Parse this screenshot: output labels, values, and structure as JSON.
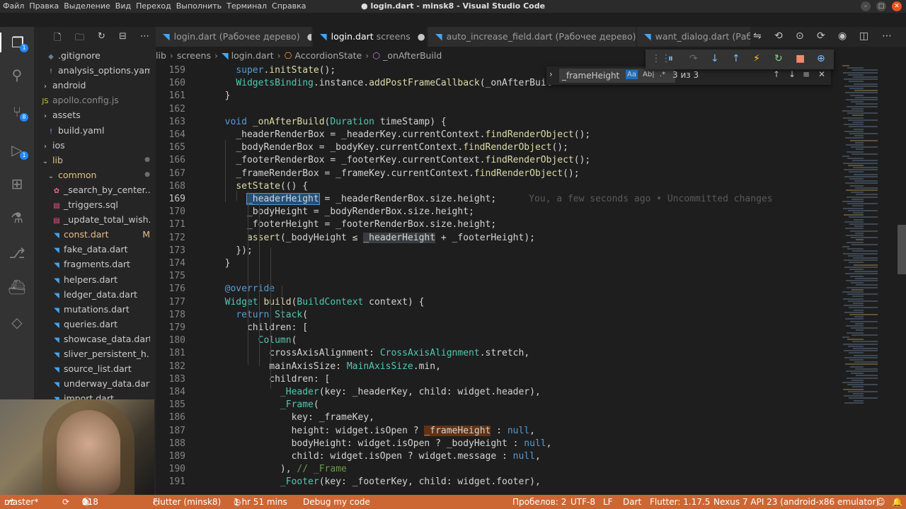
{
  "window": {
    "menu": [
      "Файл",
      "Правка",
      "Выделение",
      "Вид",
      "Переход",
      "Выполнить",
      "Терминал",
      "Справка"
    ],
    "title": "login.dart - minsk8 - Visual Studio Code"
  },
  "explorer": {
    "items": [
      {
        "label": ".gitignore",
        "icon": "git-icon",
        "chev": "",
        "state": "normal",
        "marker": ""
      },
      {
        "label": "analysis_options.yaml",
        "icon": "exclamation-icon",
        "chev": "",
        "state": "normal",
        "marker": ""
      },
      {
        "label": "android",
        "icon": "",
        "chev": "›",
        "state": "normal",
        "marker": ""
      },
      {
        "label": "apollo.config.js",
        "icon": "js-icon",
        "chev": "",
        "state": "dim",
        "marker": ""
      },
      {
        "label": "assets",
        "icon": "",
        "chev": "›",
        "state": "normal",
        "marker": ""
      },
      {
        "label": "build.yaml",
        "icon": "exclamation-icon",
        "chev": "",
        "state": "normal",
        "marker": ""
      },
      {
        "label": "ios",
        "icon": "",
        "chev": "›",
        "state": "normal",
        "marker": ""
      },
      {
        "label": "lib",
        "icon": "",
        "chev": "⌄",
        "state": "mod",
        "marker": "●"
      },
      {
        "label": "common",
        "icon": "",
        "chev": "⌄",
        "state": "mod",
        "marker": "●"
      },
      {
        "label": "_search_by_center....",
        "icon": "gear-icon",
        "chev": "",
        "state": "normal",
        "marker": ""
      },
      {
        "label": "_triggers.sql",
        "icon": "database-icon",
        "chev": "",
        "state": "normal",
        "marker": ""
      },
      {
        "label": "_update_total_wish...",
        "icon": "database-icon",
        "chev": "",
        "state": "normal",
        "marker": ""
      },
      {
        "label": "const.dart",
        "icon": "dart-icon",
        "chev": "",
        "state": "mod",
        "marker": "M"
      },
      {
        "label": "fake_data.dart",
        "icon": "dart-icon",
        "chev": "",
        "state": "normal",
        "marker": ""
      },
      {
        "label": "fragments.dart",
        "icon": "dart-icon",
        "chev": "",
        "state": "normal",
        "marker": ""
      },
      {
        "label": "helpers.dart",
        "icon": "dart-icon",
        "chev": "",
        "state": "normal",
        "marker": ""
      },
      {
        "label": "ledger_data.dart",
        "icon": "dart-icon",
        "chev": "",
        "state": "normal",
        "marker": ""
      },
      {
        "label": "mutations.dart",
        "icon": "dart-icon",
        "chev": "",
        "state": "normal",
        "marker": ""
      },
      {
        "label": "queries.dart",
        "icon": "dart-icon",
        "chev": "",
        "state": "normal",
        "marker": ""
      },
      {
        "label": "showcase_data.dart",
        "icon": "dart-icon",
        "chev": "",
        "state": "normal",
        "marker": ""
      },
      {
        "label": "sliver_persistent_h...",
        "icon": "dart-icon",
        "chev": "",
        "state": "normal",
        "marker": ""
      },
      {
        "label": "source_list.dart",
        "icon": "dart-icon",
        "chev": "",
        "state": "normal",
        "marker": ""
      },
      {
        "label": "underway_data.dart",
        "icon": "dart-icon",
        "chev": "",
        "state": "normal",
        "marker": ""
      },
      {
        "label": "import.dart",
        "icon": "dart-icon",
        "chev": "",
        "state": "normal",
        "marker": ""
      }
    ]
  },
  "activity_badges": {
    "scm": "8",
    "debug": "1",
    "explorer": "1"
  },
  "tabs": [
    {
      "label": "login.dart",
      "desc": "(Рабочее дерево)",
      "marker": "●",
      "active": false
    },
    {
      "label": "login.dart",
      "desc": "screens",
      "marker": "●",
      "active": true
    },
    {
      "label": "auto_increase_field.dart",
      "desc": "(Рабочее дерево)",
      "marker": "",
      "active": false
    },
    {
      "label": "want_dialog.dart",
      "desc": "(Рабо",
      "marker": "",
      "active": false
    }
  ],
  "breadcrumbs": [
    "lib",
    "screens",
    "login.dart",
    "AccordionState",
    "_onAfterBuild"
  ],
  "find": {
    "query": "_frameHeight",
    "case_label": "Aa",
    "word_label": "Ab|",
    "regex_label": ".*",
    "count": "3 из 3"
  },
  "code": {
    "blame": "You, a few seconds ago • Uncommitted changes",
    "current_line": "169",
    "lines": [
      {
        "n": "159",
        "segs": [
          [
            "    ",
            ""
          ],
          [
            "super",
            "kw"
          ],
          [
            ".",
            ""
          ],
          [
            "initState",
            "fn"
          ],
          [
            "();",
            ""
          ]
        ]
      },
      {
        "n": "160",
        "segs": [
          [
            "    ",
            ""
          ],
          [
            "WidgetsBinding",
            "ty"
          ],
          [
            ".",
            ""
          ],
          [
            "instance",
            ""
          ],
          [
            ".",
            ""
          ],
          [
            "addPostFrameCallback",
            "fn"
          ],
          [
            "(",
            ""
          ],
          [
            "_onAfterBuil",
            ""
          ]
        ]
      },
      {
        "n": "161",
        "segs": [
          [
            "  }",
            ""
          ]
        ]
      },
      {
        "n": "162",
        "segs": [
          [
            "",
            ""
          ]
        ]
      },
      {
        "n": "163",
        "segs": [
          [
            "  ",
            ""
          ],
          [
            "void",
            "kw"
          ],
          [
            " ",
            ""
          ],
          [
            "_onAfterBuild",
            "fn"
          ],
          [
            "(",
            ""
          ],
          [
            "Duration",
            "ty"
          ],
          [
            " timeStamp) {",
            ""
          ]
        ]
      },
      {
        "n": "164",
        "segs": [
          [
            "    _headerRenderBox = _headerKey.currentContext.",
            ""
          ],
          [
            "findRenderObject",
            "fn"
          ],
          [
            "();",
            ""
          ]
        ]
      },
      {
        "n": "165",
        "segs": [
          [
            "    _bodyRenderBox = _bodyKey.currentContext.",
            ""
          ],
          [
            "findRenderObject",
            "fn"
          ],
          [
            "();",
            ""
          ]
        ]
      },
      {
        "n": "166",
        "segs": [
          [
            "    _footerRenderBox = _footerKey.currentContext.",
            ""
          ],
          [
            "findRenderObject",
            "fn"
          ],
          [
            "();",
            ""
          ]
        ]
      },
      {
        "n": "167",
        "segs": [
          [
            "    _frameRenderBox = _frameKey.currentContext.",
            ""
          ],
          [
            "findRenderObject",
            "fn"
          ],
          [
            "();",
            ""
          ]
        ]
      },
      {
        "n": "168",
        "segs": [
          [
            "    ",
            ""
          ],
          [
            "setState",
            "fn"
          ],
          [
            "(() {",
            ""
          ]
        ]
      },
      {
        "n": "169",
        "segs": [
          [
            "      ",
            ""
          ],
          [
            "_headerHeight",
            "hl"
          ],
          [
            " = _headerRenderBox.size.height;",
            ""
          ]
        ]
      },
      {
        "n": "170",
        "segs": [
          [
            "      _bodyHeight = _bodyRenderBox.size.height;",
            ""
          ]
        ]
      },
      {
        "n": "171",
        "segs": [
          [
            "      _footerHeight = _footerRenderBox.size.height;",
            ""
          ]
        ]
      },
      {
        "n": "172",
        "segs": [
          [
            "      ",
            ""
          ],
          [
            "assert",
            "fn"
          ],
          [
            "(_bodyHeight ≤ ",
            ""
          ],
          [
            "_headerHeight",
            "hl2"
          ],
          [
            " + _footerHeight);",
            ""
          ]
        ]
      },
      {
        "n": "173",
        "segs": [
          [
            "    });",
            ""
          ]
        ]
      },
      {
        "n": "174",
        "segs": [
          [
            "  }",
            ""
          ]
        ]
      },
      {
        "n": "175",
        "segs": [
          [
            "",
            ""
          ]
        ]
      },
      {
        "n": "176",
        "segs": [
          [
            "  ",
            ""
          ],
          [
            "@override",
            "an"
          ]
        ]
      },
      {
        "n": "177",
        "segs": [
          [
            "  ",
            ""
          ],
          [
            "Widget",
            "ty"
          ],
          [
            " ",
            ""
          ],
          [
            "build",
            "fn"
          ],
          [
            "(",
            ""
          ],
          [
            "BuildContext",
            "ty"
          ],
          [
            " context) {",
            ""
          ]
        ]
      },
      {
        "n": "178",
        "segs": [
          [
            "    ",
            ""
          ],
          [
            "return",
            "kw"
          ],
          [
            " ",
            ""
          ],
          [
            "Stack",
            "ty"
          ],
          [
            "(",
            ""
          ]
        ]
      },
      {
        "n": "179",
        "segs": [
          [
            "      children: [",
            ""
          ]
        ]
      },
      {
        "n": "180",
        "segs": [
          [
            "        ",
            ""
          ],
          [
            "Column",
            "ty"
          ],
          [
            "(",
            ""
          ]
        ]
      },
      {
        "n": "181",
        "segs": [
          [
            "          crossAxisAlignment: ",
            ""
          ],
          [
            "CrossAxisAlignment",
            "ty"
          ],
          [
            ".stretch,",
            ""
          ]
        ]
      },
      {
        "n": "182",
        "segs": [
          [
            "          mainAxisSize: ",
            ""
          ],
          [
            "MainAxisSize",
            "ty"
          ],
          [
            ".min,",
            ""
          ]
        ]
      },
      {
        "n": "183",
        "segs": [
          [
            "          children: [",
            ""
          ]
        ]
      },
      {
        "n": "184",
        "segs": [
          [
            "            ",
            ""
          ],
          [
            "_Header",
            "ty"
          ],
          [
            "(key: _headerKey, child: widget.header),",
            ""
          ]
        ]
      },
      {
        "n": "185",
        "segs": [
          [
            "            ",
            ""
          ],
          [
            "_Frame",
            "ty"
          ],
          [
            "(",
            ""
          ]
        ]
      },
      {
        "n": "186",
        "segs": [
          [
            "              key: _frameKey,",
            ""
          ]
        ]
      },
      {
        "n": "187",
        "segs": [
          [
            "              height: widget.isOpen ? ",
            ""
          ],
          [
            "_frameHeight",
            "hl3"
          ],
          [
            " : ",
            ""
          ],
          [
            "null",
            "nl"
          ],
          [
            ",",
            ""
          ]
        ]
      },
      {
        "n": "188",
        "segs": [
          [
            "              bodyHeight: widget.isOpen ? _bodyHeight : ",
            ""
          ],
          [
            "null",
            "nl"
          ],
          [
            ",",
            ""
          ]
        ]
      },
      {
        "n": "189",
        "segs": [
          [
            "              child: widget.isOpen ? widget.message : ",
            ""
          ],
          [
            "null",
            "nl"
          ],
          [
            ",",
            ""
          ]
        ]
      },
      {
        "n": "190",
        "segs": [
          [
            "            ), ",
            ""
          ],
          [
            "// _Frame",
            "cm"
          ]
        ]
      },
      {
        "n": "191",
        "segs": [
          [
            "            ",
            ""
          ],
          [
            "_Footer",
            "ty"
          ],
          [
            "(key: _footerKey, child: widget.footer),",
            ""
          ]
        ]
      }
    ]
  },
  "statusbar": {
    "branch": "master*",
    "errors": "0",
    "warnings": "0",
    "infos": "118",
    "flutter": "Flutter (minsk8)",
    "time": "1 hr 51 mins",
    "debug": "Debug my code",
    "spaces": "Пробелов: 2",
    "encoding": "UTF-8",
    "eol": "LF",
    "lang": "Dart",
    "version": "Flutter: 1.17.5",
    "device": "Nexus 7 API 23 (android-x86 emulator)"
  }
}
